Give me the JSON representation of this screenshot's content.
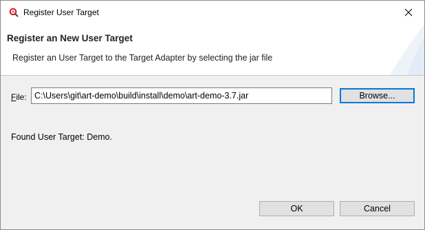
{
  "window": {
    "title": "Register User Target"
  },
  "header": {
    "title": "Register an New User Target",
    "description": "Register an User Target to the Target Adapter by selecting the jar file"
  },
  "file": {
    "label_mnemonic": "F",
    "label_rest": "ile:",
    "value": "C:\\Users\\git\\art-demo\\build\\install\\demo\\art-demo-3.7.jar",
    "browse_label": "Browse..."
  },
  "status": {
    "text": "Found User Target: Demo."
  },
  "buttons": {
    "ok_label": "OK",
    "cancel_label": "Cancel"
  },
  "icons": {
    "app": "app-logo-icon",
    "close": "close-icon"
  },
  "colors": {
    "default_button_border": "#0078d7",
    "app_icon_red": "#d7262c"
  }
}
